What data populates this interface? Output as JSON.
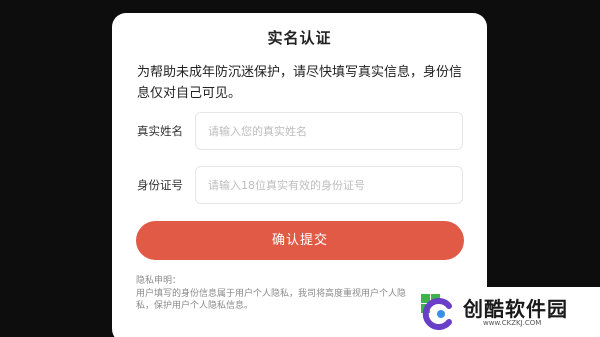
{
  "dialog": {
    "title": "实名认证",
    "intro": "为帮助未成年防沉迷保护，请尽快填写真实信息，身份信息仅对自己可见。",
    "fields": [
      {
        "label": "真实姓名",
        "placeholder": "请输入您的真实姓名",
        "value": ""
      },
      {
        "label": "身份证号",
        "placeholder": "请输入18位真实有效的身份证号",
        "value": ""
      }
    ],
    "submit_label": "确认提交",
    "privacy_title": "隐私申明：",
    "privacy_body": "用户填写的身份信息属于用户个人隐私，我司将高度重视用户个人隐私，保护用户个人隐私信息。"
  },
  "watermark": {
    "name": "创酷软件园",
    "url": "www.CKZKJ.COM",
    "colors": {
      "green": "#3cb44b",
      "purple": "#6a3fc8",
      "blue": "#3a8ee6"
    }
  },
  "colors": {
    "background": "#0d0d0d",
    "dialog_bg": "#ffffff",
    "submit_button": "#e05a45",
    "placeholder": "#bdbdbd"
  }
}
